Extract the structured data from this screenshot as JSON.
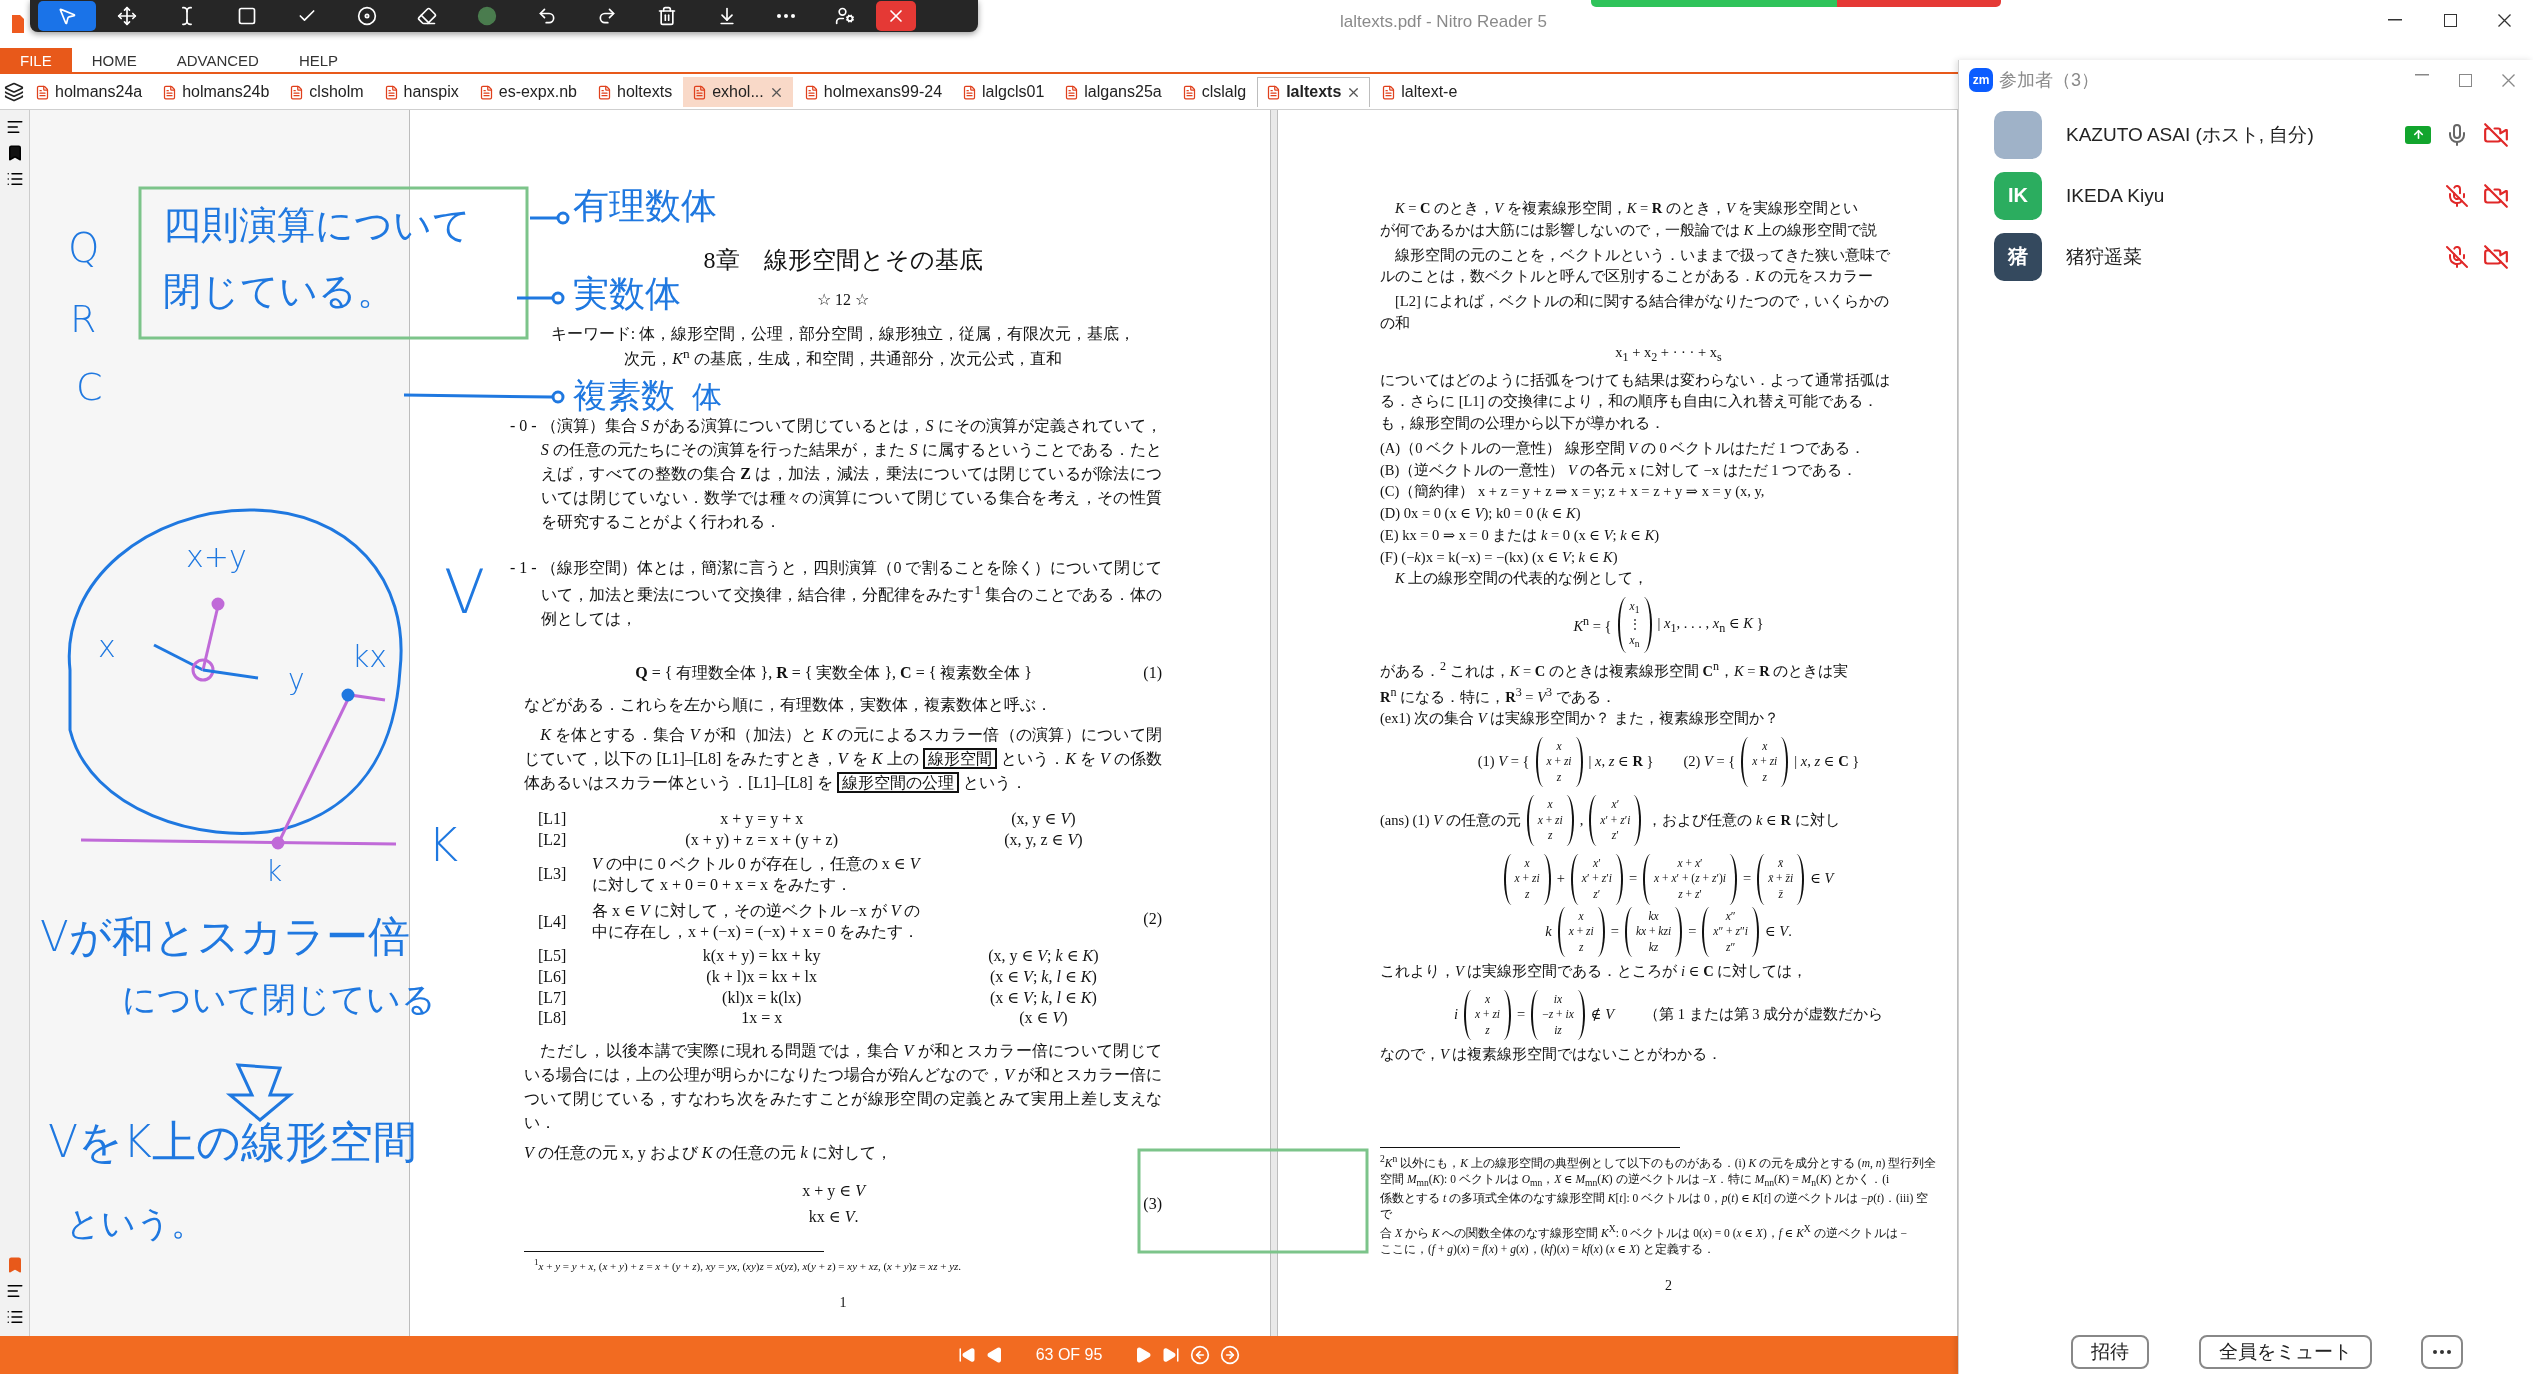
{
  "window": {
    "title": "laltexts.pdf - Nitro Reader 5"
  },
  "tools": [
    {
      "kind": "pointer",
      "selected": true
    },
    {
      "kind": "move",
      "selected": false
    },
    {
      "kind": "text",
      "selected": false
    },
    {
      "kind": "rectangle",
      "selected": false
    },
    {
      "kind": "check",
      "selected": false
    },
    {
      "kind": "target",
      "selected": false
    },
    {
      "kind": "eraser",
      "selected": false
    },
    {
      "kind": "color",
      "selected": false
    },
    {
      "kind": "undo",
      "selected": false
    },
    {
      "kind": "redo",
      "selected": false
    },
    {
      "kind": "trash",
      "selected": false
    },
    {
      "kind": "save",
      "selected": false
    },
    {
      "kind": "more",
      "selected": false
    },
    {
      "kind": "user",
      "selected": false
    },
    {
      "kind": "close",
      "selected": false
    }
  ],
  "menu": [
    {
      "label": "FILE",
      "selected": true
    },
    {
      "label": "HOME",
      "selected": false
    },
    {
      "label": "ADVANCED",
      "selected": false
    },
    {
      "label": "HELP",
      "selected": false
    }
  ],
  "tabs": [
    {
      "label": "holmans24a",
      "selected": false,
      "hover": false
    },
    {
      "label": "holmans24b",
      "selected": false,
      "hover": false
    },
    {
      "label": "clsholm",
      "selected": false,
      "hover": false
    },
    {
      "label": "hanspix",
      "selected": false,
      "hover": false
    },
    {
      "label": "es-expx.nb",
      "selected": false,
      "hover": false
    },
    {
      "label": "holtexts",
      "selected": false,
      "hover": false
    },
    {
      "label": "exhol...",
      "selected": false,
      "hover": true
    },
    {
      "label": "holmexans99-24",
      "selected": false,
      "hover": false
    },
    {
      "label": "lalgcls01",
      "selected": false,
      "hover": false
    },
    {
      "label": "lalgans25a",
      "selected": false,
      "hover": false
    },
    {
      "label": "clslalg",
      "selected": false,
      "hover": false
    },
    {
      "label": "laltexts",
      "selected": true,
      "hover": false
    },
    {
      "label": "laltext-e",
      "selected": false,
      "hover": false
    }
  ],
  "page_1": {
    "blocks": [
      {
        "kind": "title",
        "text": "8章　線形空間とその基底"
      },
      {
        "kind": "center",
        "text": "☆ 12 ☆"
      },
      {
        "kind": "keywords",
        "text": "キーワード: 体，線形空間，公理，部分空間，線形独立，従属，有限次元，基底，次元，*K*$^{n}$ の基底，生成，和空間，共通部分，次元公式，直和"
      },
      {
        "kind": "numbered",
        "label": "- 0 -",
        "text": "（演算）集合 *S* がある演算について閉じているとは，*S* にその演算が定義されていて，*S* の任意の元たちにその演算を行った結果が，また *S* に属するということである．たとえば，すべての整数の集合 **Z** は，加法，減法，乗法については閉じているが除法については閉じていない．数学では種々の演算について閉じている集合を考え，その性質を研究することがよく行われる．"
      },
      {
        "kind": "numbered",
        "label": "- 1 -",
        "text": "（線形空間）体とは，簡潔に言うと，四則演算（0 で割ることを除く）について閉じていて，加法と乗法について交換律，結合律，分配律をみたす$^{1}$ 集合のことである．体の例としては，"
      },
      {
        "kind": "equation",
        "lines": [
          {
            "parts": [
              "**Q** = { 有理数全体 },  **R** = { 実数全体 },  **C** = { 複素数全体 }"
            ]
          }
        ],
        "number": "(1)"
      },
      {
        "kind": "para",
        "segments": [
          {
            "text": "などがある．これらを左から順に，有理数体，実数体，複素数体と呼ぶ．",
            "boxed": false
          }
        ]
      },
      {
        "kind": "para",
        "segments": [
          {
            "text": "　*K* を体とする．集合 *V* が和（加法）と *K* の元によるスカラー倍（の演算）について閉じていて，以下の [L1]–[L8] をみたすとき，*V* を *K* 上の ",
            "boxed": false
          },
          {
            "text": "線形空間",
            "boxed": true
          },
          {
            "text": " という．*K* を *V* の係数体あるいはスカラー体という．[L1]–[L8] を ",
            "boxed": false
          },
          {
            "text": "線形空間の公理",
            "boxed": true
          },
          {
            "text": " という．",
            "boxed": false
          }
        ]
      },
      {
        "kind": "axioms",
        "number": "(2)",
        "rows": [
          {
            "label": "[L1]",
            "lines": [
              "x + y = y + x"
            ],
            "condition": "(x, y ∈ *V*)"
          },
          {
            "label": "[L2]",
            "lines": [
              "(x + y) + z = x + (y + z)"
            ],
            "condition": "(x, y, z ∈ *V*)"
          },
          {
            "label": "[L3]",
            "lines": [
              "*V* の中に 0 ベクトル 0 が存在し，任意の x ∈ *V*",
              "に対して x + 0 = 0 + x = x をみたす．"
            ]
          },
          {
            "label": "[L4]",
            "lines": [
              "各 x ∈ *V* に対して，その逆ベクトル −x が *V* の",
              "中に存在し，x + (−x) = (−x) + x = 0 をみたす．"
            ]
          },
          {
            "label": "[L5]",
            "lines": [
              "k(x + y) = kx + ky"
            ],
            "condition": "(x, y ∈ *V*;  *k* ∈ *K*)"
          },
          {
            "label": "[L6]",
            "lines": [
              "(k + l)x = kx + lx"
            ],
            "condition": "(x ∈ *V*;  *k*, *l* ∈ *K*)"
          },
          {
            "label": "[L7]",
            "lines": [
              "(kl)x = k(lx)"
            ],
            "condition": "(x ∈ *V*;  *k*, *l* ∈ *K*)"
          },
          {
            "label": "[L8]",
            "lines": [
              "1x = x"
            ],
            "condition": "(x ∈ *V*)"
          }
        ]
      },
      {
        "kind": "para",
        "segments": [
          {
            "text": "　ただし，以後本講で実際に現れる問題では，集合 *V* が和とスカラー倍について閉じている場合には，上の公理が明らかになりたつ場合が殆んどなので，*V* が和とスカラー倍について閉じている，すなわち次をみたすことが線形空間の定義とみて実用上差し支えない．",
            "boxed": false
          }
        ]
      },
      {
        "kind": "para",
        "segments": [
          {
            "text": "*V* の任意の元 x, y および *K* の任意の元 *k* に対して，",
            "boxed": false
          }
        ]
      },
      {
        "kind": "equation",
        "lines": [
          {
            "parts": [
              "x + y  ∈ *V*"
            ]
          },
          {
            "parts": [
              "kx  ∈ *V*."
            ]
          }
        ],
        "number": "(3)"
      }
    ],
    "footnote": "$^{1}$*x* + *y* = *y* + *x*, (*x* + *y*) + *z* = *x* + (*y* + *z*), *xy* = *yx*, (*xy*)*z* = *x*(*yz*), *x*(*y* + *z*) = *xy* + *xz*, (*x* + *y*)*z* = *xz* + *yz*.",
    "page_number": "1"
  },
  "page_2": {
    "blocks": [
      {
        "kind": "lines",
        "lines": [
          "　*K* = **C** のとき，*V* を複素線形空間，*K* = **R** のとき，*V* を実線形空間とい",
          "が何であるかは大筋には影響しないので，一般論では *K* 上の線形空間で説"
        ]
      },
      {
        "kind": "lines",
        "lines": [
          "　線形空間の元のことを，ベクトルという．いままで扱ってきた狭い意味で",
          "ルのことは，数ベクトルと呼んで区別することがある．*K* の元をスカラー"
        ]
      },
      {
        "kind": "lines",
        "lines": [
          "　[L2] によれば，ベクトルの和に関する結合律がなりたつので，いくらかの",
          "の和"
        ]
      },
      {
        "kind": "equation",
        "lines": [
          {
            "parts": [
              "x$_{1}$ + x$_{2}$ + · · · + x$_{s}$"
            ]
          }
        ]
      },
      {
        "kind": "lines",
        "lines": [
          "についてはどのように括弧をつけても結果は変わらない．よって通常括弧は",
          "る．さらに [L1] の交換律により，和の順序も自由に入れ替え可能である．",
          "も，線形空間の公理から以下が導かれる．"
        ]
      },
      {
        "kind": "lines",
        "lines": [
          "(A)（0 ベクトルの一意性）  線形空間 *V* の 0 ベクトルはただ 1 つである．",
          "(B)（逆ベクトルの一意性）  *V* の各元 x に対して −x はただ 1 つである．",
          "(C)（簡約律）  x + z = y + z ⇒ x = y;   z + x = z + y ⇒ x = y    (x, y,",
          "(D)  0x = 0   (x ∈ *V*);       k0 = 0   (*k* ∈ *K*)",
          "(E)  kx = 0 ⇒ x = 0 または *k* = 0      (x ∈ *V*;  *k* ∈ *K*)",
          "(F)  (−*k*)x = k(−x) = −(kx)      (x ∈ *V*;  *k* ∈ *K*)",
          "　*K* 上の線形空間の代表的な例として，"
        ]
      },
      {
        "kind": "equation",
        "lines": [
          {
            "parts": [
              "*K*$^{n}$ = {",
              {
                "vector": [
                  "*x*$_{1}$",
                  "⋮",
                  "*x*$_{n}$"
                ]
              },
              "| *x*$_{1}$, . . . , *x*$_{n}$ ∈ *K* }"
            ]
          }
        ]
      },
      {
        "kind": "lines",
        "lines": [
          "がある．$^{2}$ これは，*K* = **C** のときは複素線形空間 **C**$^{n}$，*K* = **R** のときは実",
          "**R**$^{n}$ になる．特に，**R**$^{3}$ = *V*$^{3}$ である．",
          "(ex1) 次の集合 *V* は実線形空間か？ また，複素線形空間か？"
        ]
      },
      {
        "kind": "equation",
        "lines": [
          {
            "parts": [
              "(1) *V* = {",
              {
                "vector": [
                  "*x*",
                  "*x* + *zi*",
                  "*z*"
                ]
              },
              "| *x*, *z* ∈ **R** }　　(2) *V* = {",
              {
                "vector": [
                  "*x*",
                  "*x* + *zi*",
                  "*z*"
                ]
              },
              "| *x*, *z* ∈ **C** }"
            ]
          }
        ]
      },
      {
        "kind": "inline_equation",
        "lines": [
          {
            "parts": [
              "(ans) (1) *V* の任意の元",
              {
                "vector": [
                  "*x*",
                  "*x* + *zi*",
                  "*z*"
                ]
              },
              ",",
              {
                "vector": [
                  "*x*′",
                  "*x*′ + *z*′*i*",
                  "*z*′"
                ]
              },
              "，および任意の *k* ∈ **R** に対し"
            ]
          }
        ]
      },
      {
        "kind": "equation",
        "lines": [
          {
            "parts": [
              {
                "vector": [
                  "*x*",
                  "*x* + *zi*",
                  "*z*"
                ]
              },
              "+",
              {
                "vector": [
                  "*x*′",
                  "*x*′ + *z*′*i*",
                  "*z*′"
                ]
              },
              "=",
              {
                "vector": [
                  "*x* + *x*′",
                  "*x* + *x*′ + (*z* + *z*′)*i*",
                  "*z* + *z*′"
                ]
              },
              "=",
              {
                "vector": [
                  "*x̄*",
                  "*x̄* + *z̄i*",
                  "*z̄*"
                ]
              },
              "∈ *V*"
            ]
          },
          {
            "parts": [
              "*k*",
              {
                "vector": [
                  "*x*",
                  "*x* + *zi*",
                  "*z*"
                ]
              },
              "=",
              {
                "vector": [
                  "*kx*",
                  "*kx* + *kzi*",
                  "*kz*"
                ]
              },
              "=",
              {
                "vector": [
                  "*x*″",
                  "*x*″ + *z*″*i*",
                  "*z*″"
                ]
              },
              "∈ *V*."
            ]
          }
        ]
      },
      {
        "kind": "lines",
        "lines": [
          "これより，*V* は実線形空間である．ところが *i* ∈ **C** に対しては，"
        ]
      },
      {
        "kind": "equation",
        "lines": [
          {
            "parts": [
              "*i*",
              {
                "vector": [
                  "*x*",
                  "*x* + *zi*",
                  "*z*"
                ]
              },
              "=",
              {
                "vector": [
                  "*ix*",
                  "−*z* + *ix*",
                  "*iz*"
                ]
              },
              "∉ *V*　　（第 1 または第 3 成分が虚数だから"
            ]
          }
        ]
      },
      {
        "kind": "lines",
        "lines": [
          "なので，*V* は複素線形空間ではないことがわかる．"
        ]
      }
    ],
    "footnote_lines": [
      "$^{2}$*K*$^{n}$ 以外にも，*K* 上の線形空間の典型例として以下のものがある．(i) *K* の元を成分とする (*m*, *n*) 型行列全",
      "空間 *M*$_{mn}$(*K*): 0 ベクトルは *O*$_{mn}$，*X* ∈ *M*$_{mn}$(*K*) の逆ベクトルは −*X*．特に *M*$_{nn}$(*K*) = *M*$_{n}$(*K*) とかく．(i",
      "係数とする *t* の多項式全体のなす線形空間 *K*[*t*]: 0 ベクトルは 0，*p*(*t*) ∈ *K*[*t*] の逆ベクトルは −*p*(*t*)．(iii) 空で",
      "合 *X* から *K* への関数全体のなす線形空間 *K*$^{X}$: 0 ベクトルは 0(*x*) = 0 (*x* ∈ *X*)，*f* ∈ *K*$^{X}$ の逆ベクトルは −",
      "ここに，(*f* + *g*)(*x*) = *f*(*x*) + *g*(*x*)，(*kf*)(*x*) = *kf*(*x*) (*x* ∈ *X*) と定義する．"
    ],
    "page_number": "2"
  },
  "ink_notes": [
    {
      "text": "Q"
    },
    {
      "text": "R"
    },
    {
      "text": "C"
    },
    {
      "text": "四則演算について"
    },
    {
      "text": "閉じている。"
    },
    {
      "text": "有理数体"
    },
    {
      "text": "実数体"
    },
    {
      "text": "複素数"
    },
    {
      "text": "体"
    },
    {
      "text": "x+y"
    },
    {
      "text": "x"
    },
    {
      "text": "y"
    },
    {
      "text": "kx"
    },
    {
      "text": "V"
    },
    {
      "text": "K"
    },
    {
      "text": "k"
    },
    {
      "text": "Vが和とスカラー倍"
    },
    {
      "text": "について閉じている"
    },
    {
      "text": "VをK上の線形空間"
    },
    {
      "text": "という。"
    }
  ],
  "status_bar": {
    "page": "63 OF 95"
  },
  "participants_panel": {
    "logo": "zm",
    "title": "参加者（3）",
    "participants": [
      {
        "name": "KAZUTO ASAI (ホスト, 自分)",
        "kind": "photo",
        "sharing": true,
        "muted": false,
        "video_off": true
      },
      {
        "name": "IKEDA Kiyu",
        "kind": "initials",
        "initials": "IK",
        "color": "#2bad5f",
        "sharing": false,
        "muted": true,
        "video_off": true
      },
      {
        "name": "猪狩遥菜",
        "kind": "initials",
        "initials": "猪",
        "color": "#34495e",
        "sharing": false,
        "muted": true,
        "video_off": true
      }
    ],
    "buttons": [
      "招待",
      "全員をミュート"
    ]
  }
}
